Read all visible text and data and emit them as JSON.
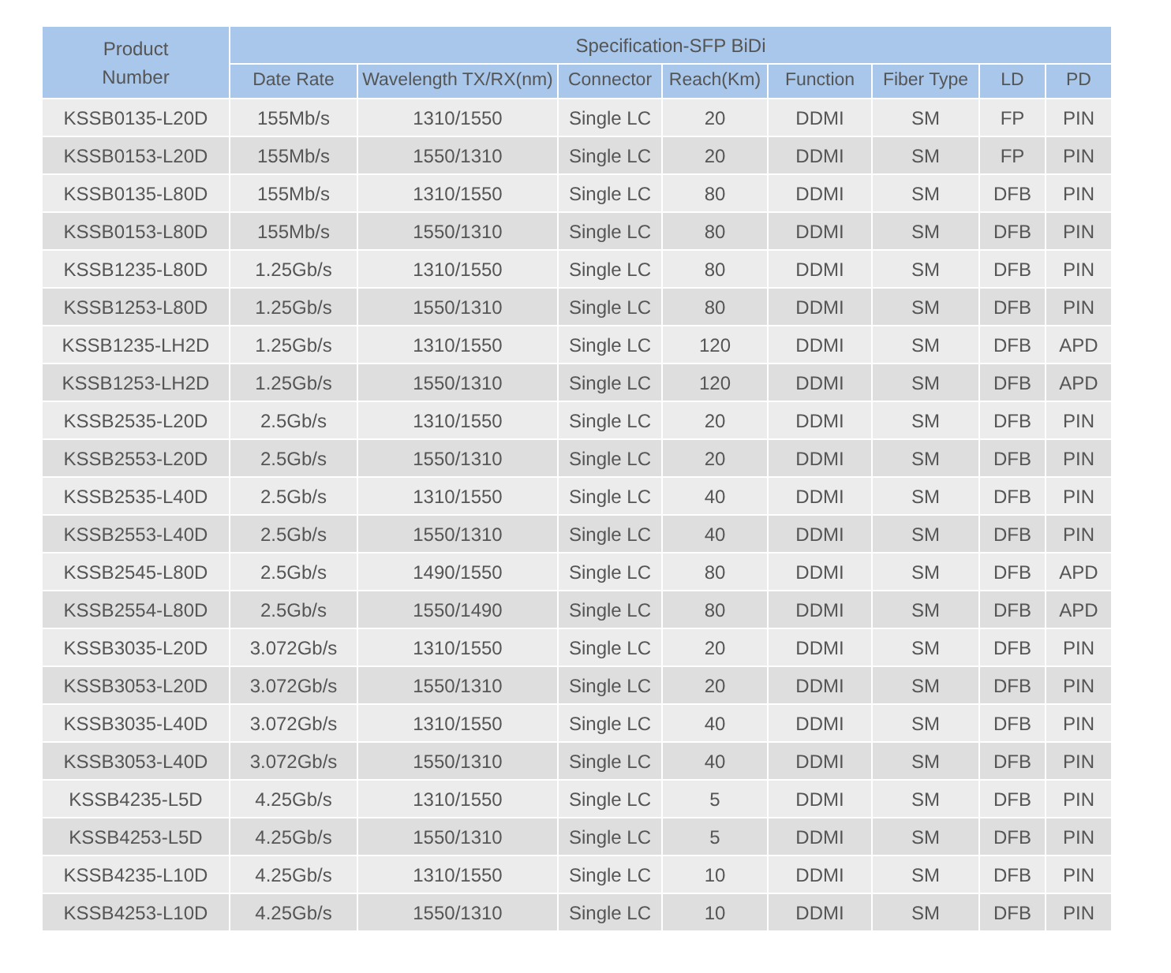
{
  "table": {
    "group_header": "Specification-SFP BiDi",
    "columns": [
      "Product Number",
      "Date Rate",
      "Wavelength TX/RX(nm)",
      "Connector",
      "Reach(Km)",
      "Function",
      "Fiber Type",
      "LD",
      "PD"
    ],
    "rows": [
      [
        "KSSB0135-L20D",
        "155Mb/s",
        "1310/1550",
        "Single LC",
        "20",
        "DDMI",
        "SM",
        "FP",
        "PIN"
      ],
      [
        "KSSB0153-L20D",
        "155Mb/s",
        "1550/1310",
        "Single LC",
        "20",
        "DDMI",
        "SM",
        "FP",
        "PIN"
      ],
      [
        "KSSB0135-L80D",
        "155Mb/s",
        "1310/1550",
        "Single LC",
        "80",
        "DDMI",
        "SM",
        "DFB",
        "PIN"
      ],
      [
        "KSSB0153-L80D",
        "155Mb/s",
        "1550/1310",
        "Single LC",
        "80",
        "DDMI",
        "SM",
        "DFB",
        "PIN"
      ],
      [
        "KSSB1235-L80D",
        "1.25Gb/s",
        "1310/1550",
        "Single LC",
        "80",
        "DDMI",
        "SM",
        "DFB",
        "PIN"
      ],
      [
        "KSSB1253-L80D",
        "1.25Gb/s",
        "1550/1310",
        "Single LC",
        "80",
        "DDMI",
        "SM",
        "DFB",
        "PIN"
      ],
      [
        "KSSB1235-LH2D",
        "1.25Gb/s",
        "1310/1550",
        "Single LC",
        "120",
        "DDMI",
        "SM",
        "DFB",
        "APD"
      ],
      [
        "KSSB1253-LH2D",
        "1.25Gb/s",
        "1550/1310",
        "Single LC",
        "120",
        "DDMI",
        "SM",
        "DFB",
        "APD"
      ],
      [
        "KSSB2535-L20D",
        "2.5Gb/s",
        "1310/1550",
        "Single LC",
        "20",
        "DDMI",
        "SM",
        "DFB",
        "PIN"
      ],
      [
        "KSSB2553-L20D",
        "2.5Gb/s",
        "1550/1310",
        "Single LC",
        "20",
        "DDMI",
        "SM",
        "DFB",
        "PIN"
      ],
      [
        "KSSB2535-L40D",
        "2.5Gb/s",
        "1310/1550",
        "Single LC",
        "40",
        "DDMI",
        "SM",
        "DFB",
        "PIN"
      ],
      [
        "KSSB2553-L40D",
        "2.5Gb/s",
        "1550/1310",
        "Single LC",
        "40",
        "DDMI",
        "SM",
        "DFB",
        "PIN"
      ],
      [
        "KSSB2545-L80D",
        "2.5Gb/s",
        "1490/1550",
        "Single LC",
        "80",
        "DDMI",
        "SM",
        "DFB",
        "APD"
      ],
      [
        "KSSB2554-L80D",
        "2.5Gb/s",
        "1550/1490",
        "Single LC",
        "80",
        "DDMI",
        "SM",
        "DFB",
        "APD"
      ],
      [
        "KSSB3035-L20D",
        "3.072Gb/s",
        "1310/1550",
        "Single LC",
        "20",
        "DDMI",
        "SM",
        "DFB",
        "PIN"
      ],
      [
        "KSSB3053-L20D",
        "3.072Gb/s",
        "1550/1310",
        "Single LC",
        "20",
        "DDMI",
        "SM",
        "DFB",
        "PIN"
      ],
      [
        "KSSB3035-L40D",
        "3.072Gb/s",
        "1310/1550",
        "Single LC",
        "40",
        "DDMI",
        "SM",
        "DFB",
        "PIN"
      ],
      [
        "KSSB3053-L40D",
        "3.072Gb/s",
        "1550/1310",
        "Single LC",
        "40",
        "DDMI",
        "SM",
        "DFB",
        "PIN"
      ],
      [
        "KSSB4235-L5D",
        "4.25Gb/s",
        "1310/1550",
        "Single LC",
        "5",
        "DDMI",
        "SM",
        "DFB",
        "PIN"
      ],
      [
        "KSSB4253-L5D",
        "4.25Gb/s",
        "1550/1310",
        "Single LC",
        "5",
        "DDMI",
        "SM",
        "DFB",
        "PIN"
      ],
      [
        "KSSB4235-L10D",
        "4.25Gb/s",
        "1310/1550",
        "Single LC",
        "10",
        "DDMI",
        "SM",
        "DFB",
        "PIN"
      ],
      [
        "KSSB4253-L10D",
        "4.25Gb/s",
        "1550/1310",
        "Single LC",
        "10",
        "DDMI",
        "SM",
        "DFB",
        "PIN"
      ]
    ]
  }
}
